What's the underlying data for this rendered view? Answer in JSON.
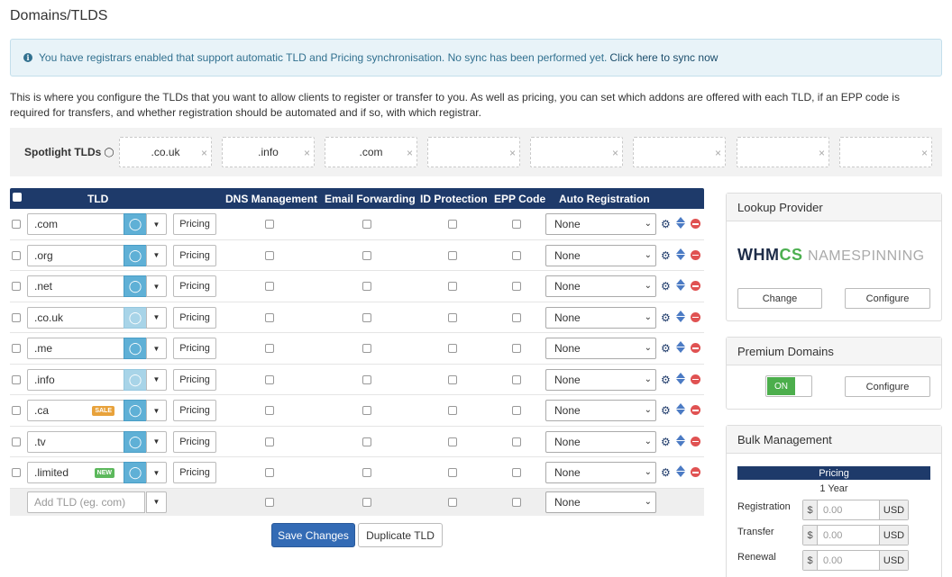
{
  "page": {
    "title": "Domains/TLDS"
  },
  "alert": {
    "text": "You have registrars enabled that support automatic TLD and Pricing synchronisation. No sync has been performed yet.",
    "link": "Click here to sync now"
  },
  "description": "This is where you configure the TLDs that you want to allow clients to register or transfer to you. As well as pricing, you can set which addons are offered with each TLD, if an EPP code is required for transfers, and whether registration should be automated and if so, with which registrar.",
  "spotlight": {
    "label": "Spotlight TLDs",
    "slots": [
      ".co.uk",
      ".info",
      ".com",
      "",
      "",
      "",
      "",
      ""
    ]
  },
  "table": {
    "headers": {
      "tld": "TLD",
      "dns": "DNS Management",
      "email": "Email Forwarding",
      "idp": "ID Protection",
      "epp": "EPP Code",
      "auto": "Auto Registration"
    },
    "pricing_label": "Pricing",
    "rows": [
      {
        "tld": ".com",
        "badge": "",
        "auto": "None"
      },
      {
        "tld": ".org",
        "badge": "",
        "auto": "None"
      },
      {
        "tld": ".net",
        "badge": "",
        "auto": "None"
      },
      {
        "tld": ".co.uk",
        "badge": "",
        "auto": "None"
      },
      {
        "tld": ".me",
        "badge": "",
        "auto": "None"
      },
      {
        "tld": ".info",
        "badge": "",
        "auto": "None"
      },
      {
        "tld": ".ca",
        "badge": "SALE",
        "auto": "None"
      },
      {
        "tld": ".tv",
        "badge": "",
        "auto": "None"
      },
      {
        "tld": ".limited",
        "badge": "NEW",
        "auto": "None"
      }
    ],
    "add_row": {
      "placeholder": "Add TLD (eg. com)",
      "auto": "None"
    }
  },
  "actions": {
    "save": "Save Changes",
    "duplicate": "Duplicate TLD"
  },
  "lookup_provider": {
    "title": "Lookup Provider",
    "logo_whm": "WHM",
    "logo_cs": "CS",
    "logo_ns": "NAMESPINNING",
    "change": "Change",
    "configure": "Configure"
  },
  "premium_domains": {
    "title": "Premium Domains",
    "toggle": "ON",
    "configure": "Configure"
  },
  "bulk_management": {
    "title": "Bulk Management",
    "pricing": "Pricing",
    "period": "1 Year",
    "currency_symbol": "$",
    "currency": "USD",
    "rows": [
      {
        "label": "Registration",
        "placeholder": "0.00"
      },
      {
        "label": "Transfer",
        "placeholder": "0.00"
      },
      {
        "label": "Renewal",
        "placeholder": "0.00"
      }
    ]
  }
}
